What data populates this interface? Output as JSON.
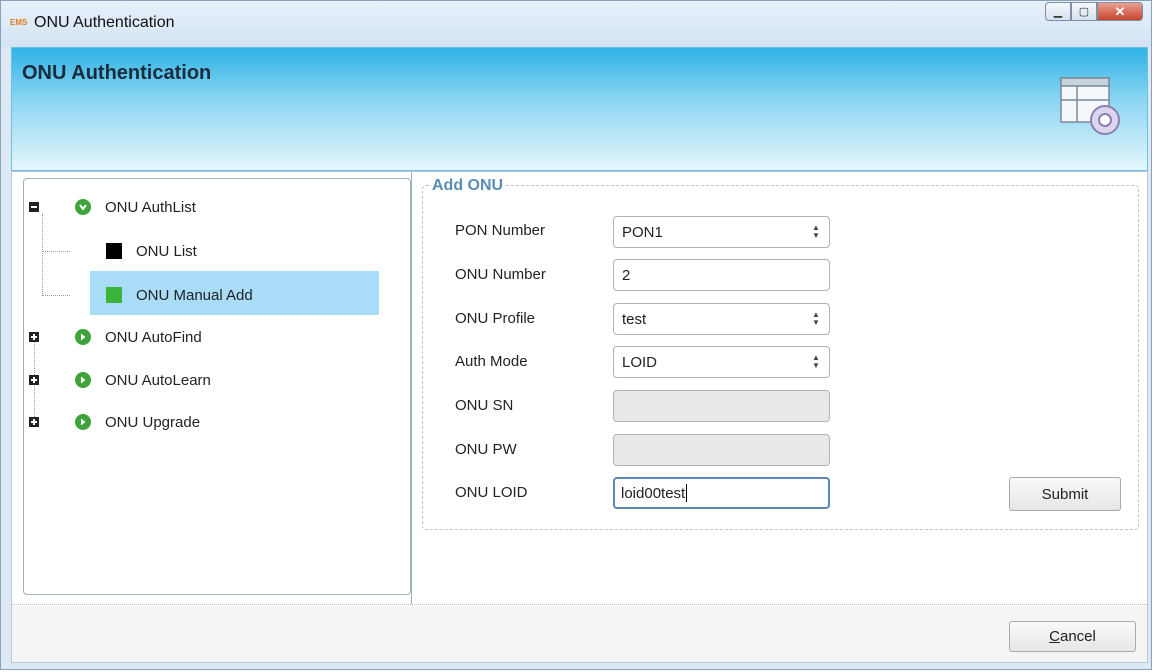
{
  "window": {
    "app_icon": "EMS",
    "title": "ONU Authentication"
  },
  "header": {
    "title": "ONU Authentication",
    "icon": "window-settings-icon"
  },
  "tree": {
    "items": [
      {
        "label": "ONU AuthList",
        "expander": "minus",
        "icon": "green-circle-down-icon"
      },
      {
        "label": "ONU List",
        "icon": "black-square-icon"
      },
      {
        "label": "ONU Manual Add",
        "icon": "green-square-icon",
        "selected": true
      },
      {
        "label": "ONU AutoFind",
        "expander": "plus",
        "icon": "green-circle-right-icon"
      },
      {
        "label": "ONU AutoLearn",
        "expander": "plus",
        "icon": "green-circle-right-icon"
      },
      {
        "label": "ONU Upgrade",
        "expander": "plus",
        "icon": "green-circle-right-icon"
      }
    ]
  },
  "form": {
    "legend": "Add ONU",
    "fields": [
      {
        "label": "PON Number",
        "value": "PON1",
        "type": "select"
      },
      {
        "label": "ONU Number",
        "value": "2",
        "type": "text"
      },
      {
        "label": "ONU Profile",
        "value": "test",
        "type": "select"
      },
      {
        "label": "Auth Mode",
        "value": "LOID",
        "type": "select"
      },
      {
        "label": "ONU SN",
        "value": "",
        "type": "text",
        "disabled": true
      },
      {
        "label": "ONU PW",
        "value": "",
        "type": "text",
        "disabled": true
      },
      {
        "label": "ONU LOID",
        "value": "loid00test",
        "type": "text",
        "focused": true
      }
    ],
    "submit_label": "Submit"
  },
  "footer": {
    "cancel_label": "Cancel",
    "cancel_mnemonic": "C",
    "cancel_rest": "ancel"
  },
  "colors": {
    "header_accent": "#2fb3e6",
    "selection": "#a8dcf7",
    "tree_icon_green": "#3da33a"
  }
}
